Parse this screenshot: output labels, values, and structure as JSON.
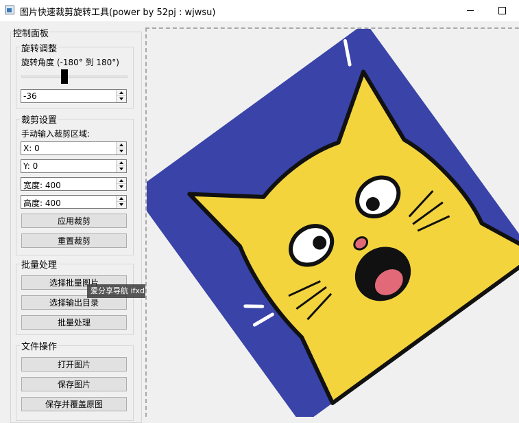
{
  "window": {
    "title": "图片快速裁剪旋转工具(power by 52pj : wjwsu)"
  },
  "control_panel": {
    "title": "控制面板",
    "rotation": {
      "group_title": "旋转调整",
      "angle_label": "旋转角度 (-180° 到 180°)",
      "angle_value": "-36",
      "slider_value": -36,
      "slider_min": -180,
      "slider_max": 180
    },
    "crop": {
      "group_title": "裁剪设置",
      "manual_label": "手动输入裁剪区域:",
      "x_field": "X: 0",
      "y_field": "Y: 0",
      "width_field": "宽度: 400",
      "height_field": "高度: 400",
      "apply_button": "应用裁剪",
      "reset_button": "重置裁剪"
    },
    "batch": {
      "group_title": "批量处理",
      "select_images_button": "选择批量图片",
      "select_output_button": "选择输出目录",
      "process_button": "批量处理"
    },
    "file_ops": {
      "group_title": "文件操作",
      "open_button": "打开图片",
      "save_button": "保存图片",
      "save_overwrite_button": "保存并覆盖原图"
    }
  },
  "overlay": {
    "watermark_text": "爱分享导航 ifxdh.com"
  },
  "colors": {
    "image_blue": "#3943a8",
    "cat_yellow": "#f3d43c",
    "mouth_pink": "#e26a78"
  },
  "icons": {
    "app": "app-icon",
    "minimize": "minimize-icon",
    "maximize": "maximize-icon"
  }
}
